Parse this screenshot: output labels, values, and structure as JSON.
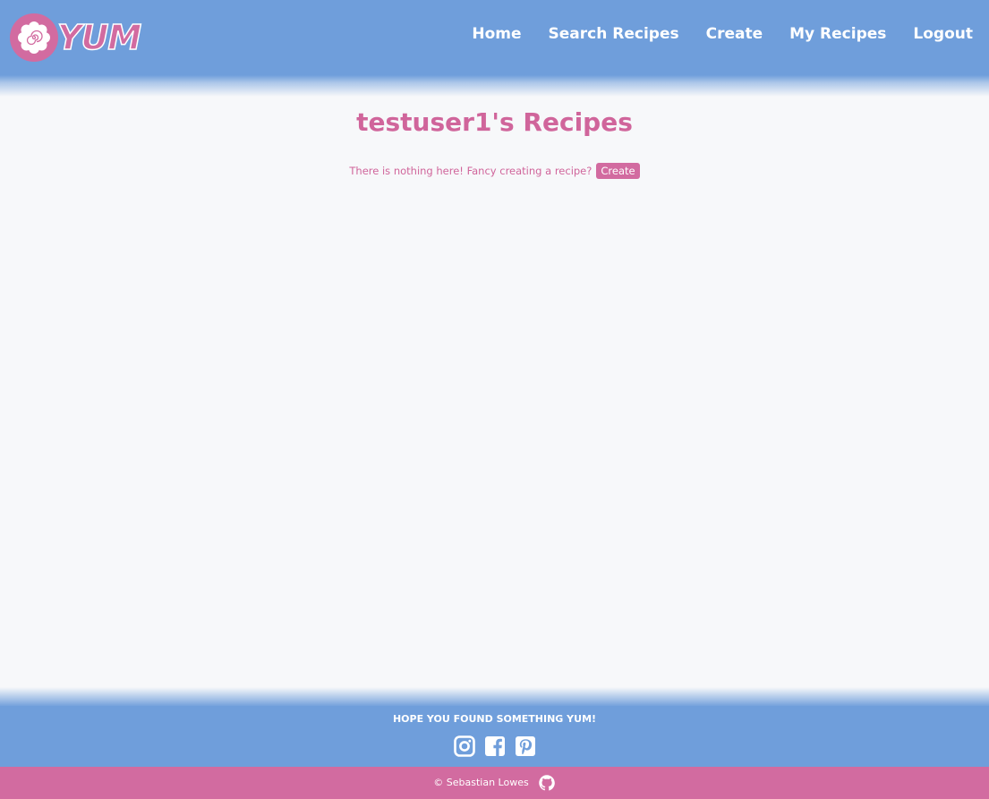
{
  "brand": {
    "name": "YUM",
    "colors": {
      "header_blue": "#6f9edb",
      "accent_pink": "#d26ba0",
      "background": "#f7f8fa"
    }
  },
  "nav": {
    "items": [
      {
        "label": "Home"
      },
      {
        "label": "Search Recipes"
      },
      {
        "label": "Create"
      },
      {
        "label": "My Recipes"
      },
      {
        "label": "Logout"
      }
    ]
  },
  "main": {
    "title": "testuser1's Recipes",
    "empty_message": "There is nothing here! Fancy creating a recipe?",
    "create_button_label": "Create"
  },
  "footer": {
    "tagline": "HOPE YOU FOUND SOMETHING YUM!",
    "social_icons": [
      "instagram-icon",
      "facebook-icon",
      "pinterest-icon"
    ],
    "copyright": "© Sebastian Lowes",
    "github_icon": "github-icon"
  }
}
